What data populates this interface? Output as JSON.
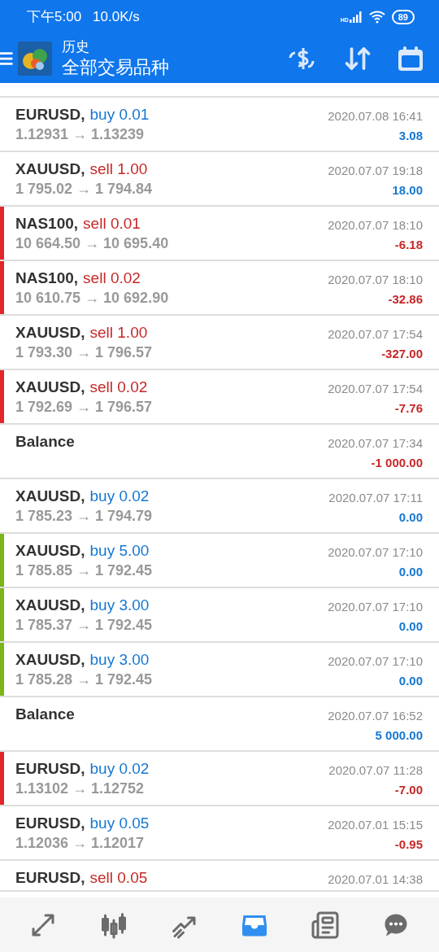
{
  "status_bar": {
    "time": "下午5:00",
    "speed": "10.0K/s",
    "signal_label": "HD",
    "battery": "89"
  },
  "header": {
    "title": "历史",
    "subtitle": "全部交易品种"
  },
  "rows": [
    {
      "kind": "buy",
      "symbol": "EURUSD,",
      "volume": "buy 0.01",
      "prices": "1.12931 → 1.13239",
      "time": "2020.07.08 16:41",
      "profit": "3.08",
      "loss": false
    },
    {
      "kind": "sell",
      "symbol": "XAUUSD,",
      "volume": "sell 1.00",
      "prices": "1 795.02 → 1 794.84",
      "time": "2020.07.07 19:18",
      "profit": "18.00",
      "loss": false
    },
    {
      "kind": "sell",
      "symbol": "NAS100,",
      "volume": "sell 0.01",
      "prices": "10 664.50 → 10 695.40",
      "time": "2020.07.07 18:10",
      "profit": "-6.18",
      "loss": true,
      "color": "#e3262a"
    },
    {
      "kind": "sell",
      "symbol": "NAS100,",
      "volume": "sell 0.02",
      "prices": "10 610.75 → 10 692.90",
      "time": "2020.07.07 18:10",
      "profit": "-32.86",
      "loss": true,
      "color": "#e3262a"
    },
    {
      "kind": "sell",
      "symbol": "XAUUSD,",
      "volume": "sell 1.00",
      "prices": "1 793.30 → 1 796.57",
      "time": "2020.07.07 17:54",
      "profit": "-327.00",
      "loss": true
    },
    {
      "kind": "sell",
      "symbol": "XAUUSD,",
      "volume": "sell 0.02",
      "prices": "1 792.69 → 1 796.57",
      "time": "2020.07.07 17:54",
      "profit": "-7.76",
      "loss": true,
      "color": "#e3262a"
    },
    {
      "kind": "balance",
      "symbol": "Balance",
      "time": "2020.07.07 17:34",
      "profit": "-1 000.00",
      "loss": true
    },
    {
      "kind": "buy",
      "symbol": "XAUUSD,",
      "volume": "buy 0.02",
      "prices": "1 785.23 → 1 794.79",
      "time": "2020.07.07 17:11",
      "profit": "0.00",
      "loss": false
    },
    {
      "kind": "buy",
      "symbol": "XAUUSD,",
      "volume": "buy 5.00",
      "prices": "1 785.85 → 1 792.45",
      "time": "2020.07.07 17:10",
      "profit": "0.00",
      "loss": false,
      "color": "#7cb518"
    },
    {
      "kind": "buy",
      "symbol": "XAUUSD,",
      "volume": "buy 3.00",
      "prices": "1 785.37 → 1 792.45",
      "time": "2020.07.07 17:10",
      "profit": "0.00",
      "loss": false,
      "color": "#7cb518"
    },
    {
      "kind": "buy",
      "symbol": "XAUUSD,",
      "volume": "buy 3.00",
      "prices": "1 785.28 → 1 792.45",
      "time": "2020.07.07 17:10",
      "profit": "0.00",
      "loss": false,
      "color": "#7cb518"
    },
    {
      "kind": "balance",
      "symbol": "Balance",
      "time": "2020.07.07 16:52",
      "profit": "5 000.00",
      "loss": false
    },
    {
      "kind": "buy",
      "symbol": "EURUSD,",
      "volume": "buy 0.02",
      "prices": "1.13102 → 1.12752",
      "time": "2020.07.07 11:28",
      "profit": "-7.00",
      "loss": true,
      "color": "#e3262a"
    },
    {
      "kind": "buy",
      "symbol": "EURUSD,",
      "volume": "buy 0.05",
      "prices": "1.12036 → 1.12017",
      "time": "2020.07.01 15:15",
      "profit": "-0.95",
      "loss": true
    },
    {
      "kind": "sell",
      "symbol": "EURUSD,",
      "volume": "sell 0.05",
      "time": "2020.07.01 14:38"
    }
  ],
  "nav": [
    {
      "selected": false
    },
    {
      "selected": false
    },
    {
      "selected": false
    },
    {
      "selected": true
    },
    {
      "selected": false
    },
    {
      "selected": false
    }
  ]
}
